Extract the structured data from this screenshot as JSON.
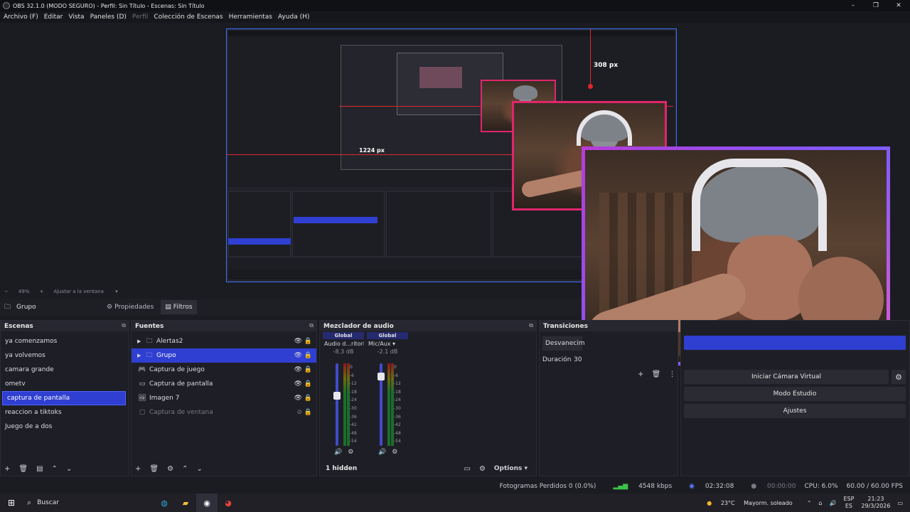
{
  "window": {
    "title": "OBS 32.1.0 (MODO SEGURO) - Perfil: Sin Título - Escenas: Sin Título",
    "min": "–",
    "max": "❐",
    "close": "✕"
  },
  "menu": {
    "items": [
      "Archivo (F)",
      "Editar",
      "Vista",
      "Paneles (D)",
      "Perfil",
      "Colección de Escenas",
      "Herramientas",
      "Ayuda (H)"
    ]
  },
  "preview": {
    "measure_height": "308 px",
    "measure_width": "1224 px",
    "zoom_pct": "49%",
    "zoom_fit": "Ajustar a la ventana"
  },
  "context": {
    "source_name": "Grupo",
    "properties": "Propiedades",
    "filters": "Filtros"
  },
  "scenes": {
    "title": "Escenas",
    "items": [
      "ya comenzamos",
      "ya volvemos",
      "camara grande",
      "ometv",
      "captura de pantalla",
      "reaccion a tiktoks",
      "Juego de a dos"
    ],
    "selected_index": 4
  },
  "sources": {
    "title": "Fuentes",
    "items": [
      {
        "name": "Alertas2",
        "icon": "folder-icon",
        "group": true,
        "selected": false,
        "visible": true
      },
      {
        "name": "Grupo",
        "icon": "folder-icon",
        "group": true,
        "selected": true,
        "visible": true
      },
      {
        "name": "Captura de juego",
        "icon": "gamepad-icon",
        "group": false,
        "selected": false,
        "visible": true
      },
      {
        "name": "Captura de pantalla",
        "icon": "monitor-icon",
        "group": false,
        "selected": false,
        "visible": true
      },
      {
        "name": "Imagen 7",
        "icon": "image-icon",
        "group": false,
        "selected": false,
        "visible": true
      },
      {
        "name": "Captura de ventana",
        "icon": "window-icon",
        "group": false,
        "selected": false,
        "visible": false
      }
    ]
  },
  "mixer": {
    "title": "Mezclador de audio",
    "channels": [
      {
        "global": "Global",
        "name": "Audio d...ritorio",
        "db": "-8.3 dB",
        "level": 0.62
      },
      {
        "global": "Global",
        "name": "Mic/Aux",
        "db": "-2.1 dB",
        "level": 0.88
      }
    ],
    "ticks": [
      "0",
      "-6",
      "-12",
      "-18",
      "-24",
      "-30",
      "-36",
      "-42",
      "-48",
      "-54",
      "-60"
    ],
    "hidden": "1 hidden",
    "options": "Options"
  },
  "transitions": {
    "title": "Transiciones",
    "current": "Desvanecim",
    "duration_label": "Duración",
    "duration_value": "30"
  },
  "controls": {
    "virtual_cam": "Iniciar Cámara Virtual",
    "studio_mode": "Modo Estudio",
    "settings": "Ajustes"
  },
  "status": {
    "dropped_frames": "Fotogramas Perdidos 0 (0.0%)",
    "bitrate": "4548 kbps",
    "stream_time": "02:32:08",
    "rec_time": "00:00:00",
    "cpu": "CPU: 6.0%",
    "fps": "60.00 / 60.00 FPS"
  },
  "taskbar": {
    "search": "Buscar",
    "weather_temp": "23°C",
    "weather_desc": "Mayorm. soleado",
    "lang": "ESP",
    "lang_sub": "ES",
    "time": "21:23",
    "date": "29/3/2026"
  },
  "colors": {
    "accent": "#2f3fd1",
    "border_pink": "#e0266a",
    "measure_red": "#e0262e"
  }
}
